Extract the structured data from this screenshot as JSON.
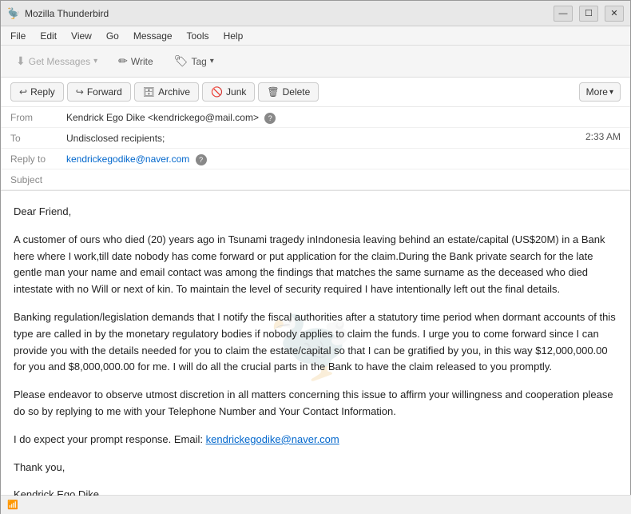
{
  "window": {
    "title": "Mozilla Thunderbird",
    "icon": "🦤"
  },
  "titlebar": {
    "minimize": "—",
    "maximize": "☐",
    "close": "✕"
  },
  "menubar": {
    "items": [
      "File",
      "Edit",
      "View",
      "Go",
      "Message",
      "Tools",
      "Help"
    ]
  },
  "toolbar": {
    "get_messages_label": "Get Messages",
    "write_label": "Write",
    "tag_label": "Tag"
  },
  "actionbar": {
    "reply_label": "Reply",
    "forward_label": "Forward",
    "archive_label": "Archive",
    "junk_label": "Junk",
    "delete_label": "Delete",
    "more_label": "More"
  },
  "email": {
    "from_label": "From",
    "from_value": "Kendrick Ego Dike <kendrickego@mail.com>",
    "to_label": "To",
    "to_value": "Undisclosed recipients;",
    "time_value": "2:33 AM",
    "reply_to_label": "Reply to",
    "reply_to_value": "kendrickegodike@naver.com",
    "subject_label": "Subject",
    "subject_value": ""
  },
  "body": {
    "greeting": "Dear Friend,",
    "paragraph1": "A customer of ours who died (20) years ago in Tsunami tragedy inIndonesia leaving behind an estate/capital (US$20M) in a Bank here where I work,till date nobody has come forward or put application for the claim.During the Bank private search for the late gentle man your name and email contact was among the findings that matches the same surname as the deceased who died intestate with no Will or next of kin. To maintain the level of security required I have intentionally left out the final details.",
    "paragraph2": "Banking regulation/legislation demands that I notify the fiscal authorities after a statutory time period when dormant accounts of this type are called in by the monetary regulatory bodies if nobody applies to claim the funds. I urge you to come forward since I can provide you with the details needed for you to claim the estate/capital so that I can be gratified by you, in this way $12,000,000.00 for you and $8,000,000.00 for me. I will do all the crucial parts in the Bank to have the claim released to you promptly.",
    "paragraph3": "Please endeavor to observe utmost discretion in all matters concerning this issue to affirm your willingness and cooperation please do so by replying to me with your Telephone Number and Your Contact Information.",
    "paragraph4_prefix": "I do expect your prompt response. Email: ",
    "paragraph4_link": "kendrickegodike@naver.com",
    "paragraph5": "Thank you,",
    "signature": "Kendrick Ego Dike"
  },
  "statusbar": {
    "connection_icon": "📶",
    "status_text": ""
  }
}
